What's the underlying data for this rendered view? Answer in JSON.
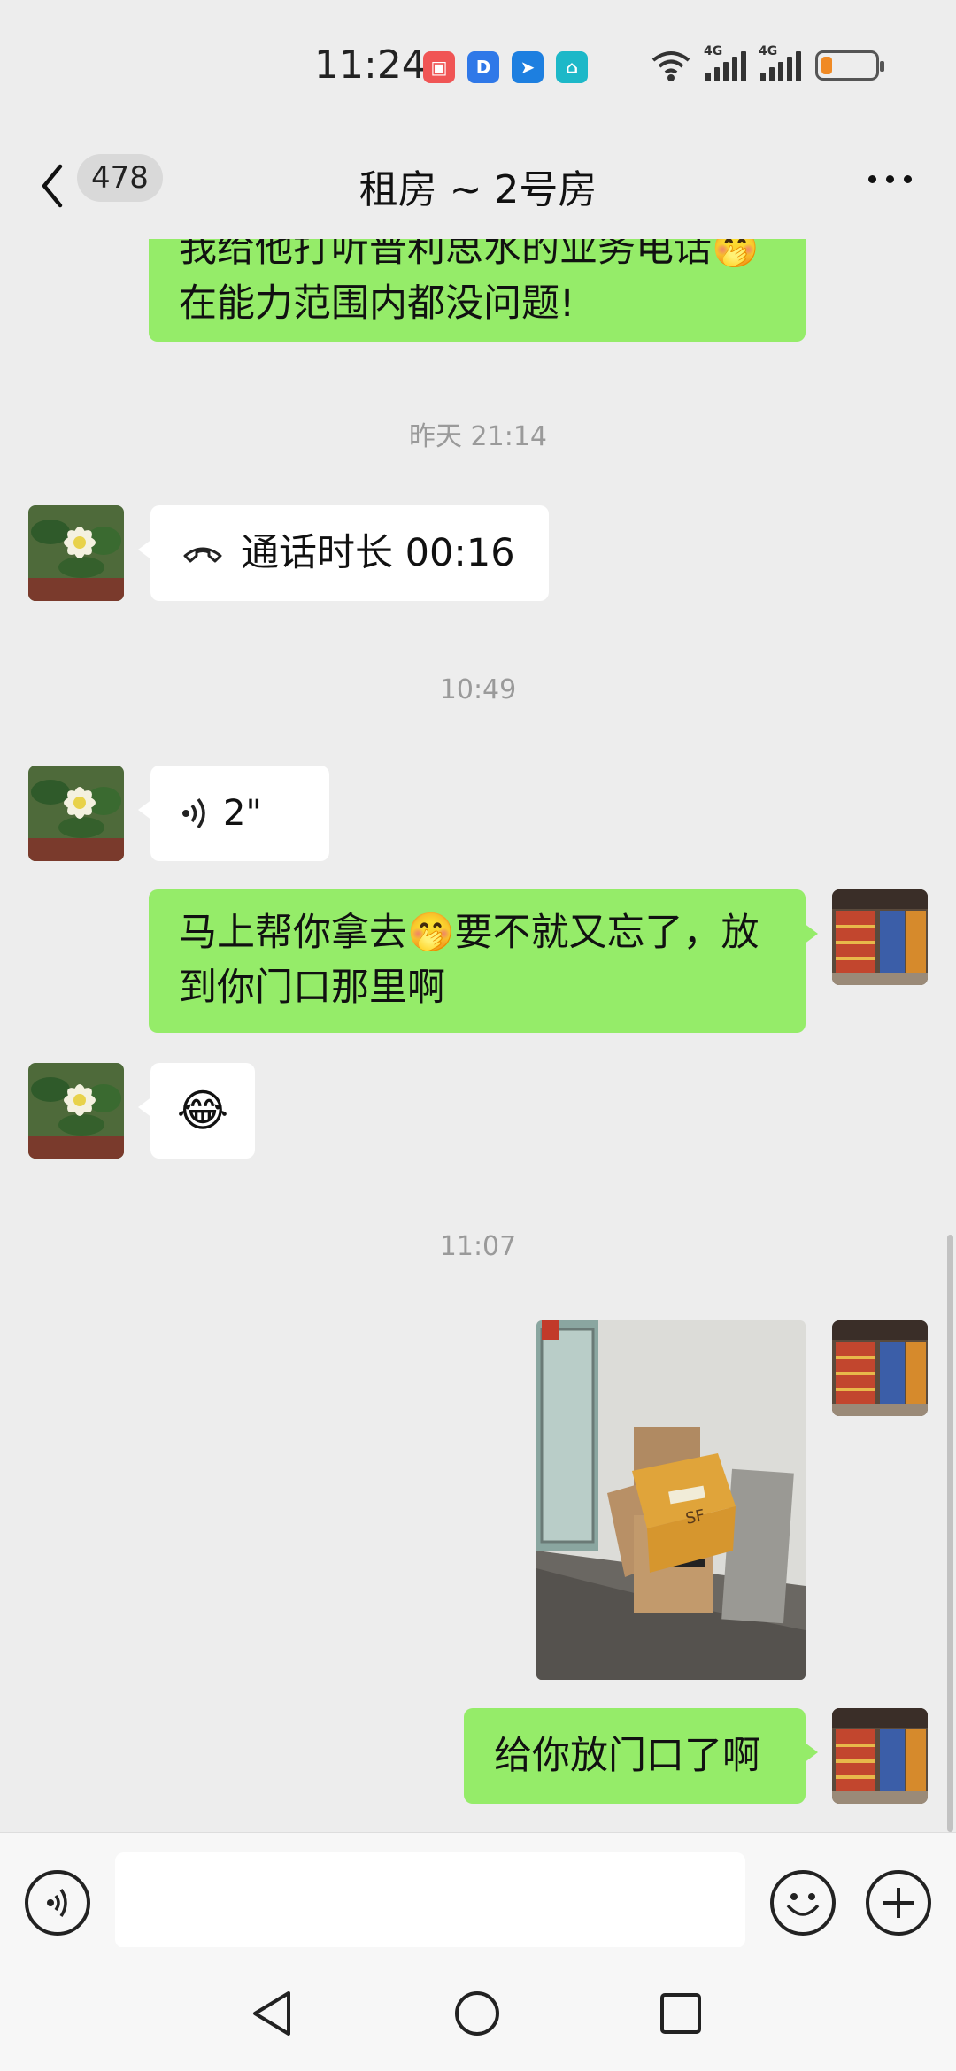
{
  "status_bar": {
    "time": "11:24",
    "network_1": "4G",
    "network_2": "4G",
    "battery_level": 0.2,
    "battery_color": "#f08a24"
  },
  "header": {
    "unread_count": "478",
    "title": "租房 ~ 2号房"
  },
  "messages": {
    "m1": {
      "line1": "我给他打听普利思水的业务电话🤭",
      "line2": "在能力范围内都没问题!"
    },
    "ts1": "昨天 21:14",
    "call": {
      "label": "通话时长 00:16"
    },
    "ts2": "10:49",
    "voice": {
      "duration": "2\""
    },
    "m2": {
      "line1": "马上帮你拿去🤭要不就又忘了，放",
      "line2": "到你门口那里啊"
    },
    "m3": {
      "emoji": "😂"
    },
    "ts3": "11:07",
    "m4": {
      "text": "给你放门口了啊"
    }
  },
  "colors": {
    "background": "#ededed",
    "sent_bubble": "#95ec69",
    "received_bubble": "#ffffff",
    "timestamp_text": "#9a9a9a"
  },
  "icons": [
    "back-icon",
    "more-icon",
    "phone-icon",
    "voice-wave-icon",
    "voice-input-icon",
    "emoji-icon",
    "add-icon",
    "nav-back-icon",
    "nav-home-icon",
    "nav-recents-icon",
    "wifi-icon",
    "battery-icon"
  ]
}
